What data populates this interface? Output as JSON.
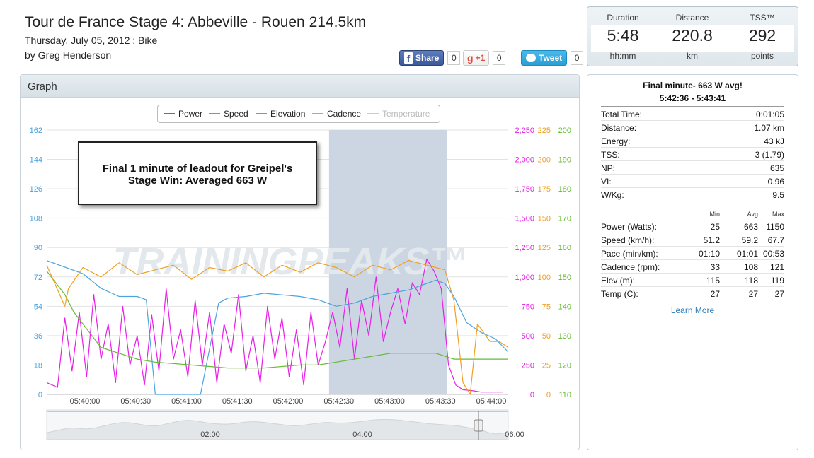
{
  "header": {
    "title": "Tour de France Stage 4: Abbeville - Rouen 214.5km",
    "date": "Thursday, July 05, 2012 : Bike",
    "author": "by Greg Henderson"
  },
  "social": {
    "facebook_label": "Share",
    "facebook_count": "0",
    "gplus_label": "+1",
    "gplus_count": "0",
    "twitter_label": "Tweet",
    "twitter_count": "0"
  },
  "summary": {
    "columns": [
      {
        "label": "Duration",
        "value": "5:48",
        "unit": "hh:mm"
      },
      {
        "label": "Distance",
        "value": "220.8",
        "unit": "km"
      },
      {
        "label": "TSS™",
        "value": "292",
        "unit": "points"
      }
    ]
  },
  "graph": {
    "title": "Graph",
    "watermark": "TRAININGPEAKS™",
    "annotation_line1": "Final 1 minute of leadout for Greipel's",
    "annotation_line2": "Stage Win: Averaged 663 W",
    "legend": [
      {
        "label": "Power",
        "color": "#e81ee8"
      },
      {
        "label": "Speed",
        "color": "#4aa3df"
      },
      {
        "label": "Elevation",
        "color": "#66bb33"
      },
      {
        "label": "Cadence",
        "color": "#f0a022"
      },
      {
        "label": "Temperature",
        "color": "#cccccc"
      }
    ],
    "navigator_ticks": [
      "02:00",
      "04:00",
      "06:00"
    ]
  },
  "chart_data": {
    "type": "line",
    "x_ticks": [
      "05:40:00",
      "05:40:30",
      "05:41:00",
      "05:41:30",
      "05:42:00",
      "05:42:30",
      "05:43:00",
      "05:43:30",
      "05:44:00"
    ],
    "axes": [
      {
        "name": "speed",
        "color": "#4aa3df",
        "ticks": [
          "162",
          "144",
          "126",
          "108",
          "90",
          "72",
          "54",
          "36",
          "18",
          "0"
        ]
      },
      {
        "name": "power",
        "color": "#e81ee8",
        "ticks": [
          "2,250",
          "2,000",
          "1,750",
          "1,500",
          "1,250",
          "1,000",
          "750",
          "500",
          "250",
          "0"
        ]
      },
      {
        "name": "cadence",
        "color": "#f0a022",
        "ticks": [
          "225",
          "200",
          "175",
          "150",
          "125",
          "100",
          "75",
          "50",
          "25",
          "0"
        ]
      },
      {
        "name": "elevation",
        "color": "#66bb33",
        "ticks": [
          "200",
          "190",
          "180",
          "170",
          "160",
          "150",
          "140",
          "130",
          "120",
          "110"
        ]
      }
    ],
    "x_range_seconds": [
      0,
      255
    ],
    "selection_seconds": [
      156,
      221
    ],
    "series": [
      {
        "name": "Power",
        "color": "#e81ee8",
        "axis": "power",
        "x": [
          0,
          6,
          10,
          14,
          18,
          22,
          26,
          30,
          34,
          38,
          42,
          46,
          50,
          54,
          58,
          62,
          66,
          70,
          74,
          78,
          82,
          86,
          90,
          94,
          98,
          102,
          106,
          110,
          114,
          118,
          122,
          126,
          130,
          134,
          138,
          142,
          146,
          150,
          154,
          158,
          162,
          166,
          170,
          174,
          178,
          182,
          186,
          190,
          194,
          198,
          202,
          206,
          210,
          214,
          218,
          222,
          226,
          230,
          236,
          240,
          246,
          252
        ],
        "values": [
          100,
          60,
          650,
          200,
          700,
          150,
          850,
          300,
          600,
          100,
          750,
          250,
          500,
          80,
          680,
          200,
          900,
          300,
          550,
          150,
          800,
          250,
          700,
          100,
          600,
          350,
          850,
          200,
          500,
          100,
          750,
          300,
          650,
          150,
          550,
          80,
          700,
          250,
          450,
          700,
          400,
          900,
          300,
          800,
          500,
          1000,
          450,
          700,
          900,
          600,
          950,
          850,
          1150,
          1050,
          900,
          250,
          80,
          40,
          30,
          20,
          20,
          20
        ]
      },
      {
        "name": "Speed",
        "color": "#4aa3df",
        "axis": "speed",
        "x": [
          0,
          10,
          20,
          30,
          40,
          50,
          55,
          60,
          62,
          75,
          85,
          95,
          100,
          110,
          120,
          130,
          140,
          150,
          155,
          160,
          170,
          180,
          190,
          200,
          210,
          215,
          220,
          225,
          232,
          240,
          248,
          255
        ],
        "values": [
          82,
          78,
          74,
          65,
          60,
          60,
          58,
          0,
          0,
          0,
          0,
          56,
          59,
          60,
          62,
          61,
          60,
          58,
          56,
          54,
          56,
          60,
          62,
          64,
          68,
          70,
          68,
          60,
          44,
          38,
          34,
          26
        ]
      },
      {
        "name": "Elevation",
        "color": "#66bb33",
        "axis": "elevation",
        "x": [
          0,
          5,
          10,
          15,
          20,
          30,
          40,
          50,
          60,
          80,
          100,
          120,
          140,
          150,
          160,
          170,
          180,
          190,
          200,
          210,
          215,
          220,
          225,
          230,
          240,
          255
        ],
        "values": [
          152,
          148,
          144,
          138,
          134,
          126,
          124,
          122,
          121,
          120,
          119,
          119,
          120,
          120,
          121,
          122,
          123,
          124,
          124,
          124,
          124,
          123,
          122,
          122,
          122,
          122
        ]
      },
      {
        "name": "Cadence",
        "color": "#f0a022",
        "axis": "cadence",
        "x": [
          0,
          10,
          12,
          20,
          30,
          40,
          50,
          60,
          70,
          80,
          90,
          100,
          110,
          120,
          130,
          140,
          150,
          160,
          170,
          180,
          190,
          200,
          210,
          220,
          225,
          230,
          234,
          238,
          245,
          250,
          255
        ],
        "values": [
          110,
          75,
          90,
          108,
          100,
          112,
          102,
          106,
          110,
          98,
          108,
          105,
          112,
          100,
          110,
          104,
          112,
          108,
          100,
          110,
          106,
          114,
          110,
          106,
          80,
          10,
          0,
          60,
          45,
          45,
          40
        ]
      }
    ]
  },
  "stats": {
    "title": "Final minute- 663 W avg!",
    "range": "5:42:36 - 5:43:41",
    "summary_rows": [
      {
        "label": "Total Time:",
        "value": "0:01:05"
      },
      {
        "label": "Distance:",
        "value": "1.07 km"
      },
      {
        "label": "Energy:",
        "value": "43 kJ"
      },
      {
        "label": "TSS:",
        "value": "3 (1.79)"
      },
      {
        "label": "NP:",
        "value": "635"
      },
      {
        "label": "VI:",
        "value": "0.96"
      },
      {
        "label": "W/Kg:",
        "value": "9.5"
      }
    ],
    "col_headers": [
      "Min",
      "Avg",
      "Max"
    ],
    "metric_rows": [
      {
        "label": "Power (Watts):",
        "min": "25",
        "avg": "663",
        "max": "1150"
      },
      {
        "label": "Speed (km/h):",
        "min": "51.2",
        "avg": "59.2",
        "max": "67.7"
      },
      {
        "label": "Pace (min/km):",
        "min": "01:10",
        "avg": "01:01",
        "max": "00:53"
      },
      {
        "label": "Cadence (rpm):",
        "min": "33",
        "avg": "108",
        "max": "121"
      },
      {
        "label": "Elev (m):",
        "min": "115",
        "avg": "118",
        "max": "119"
      },
      {
        "label": "Temp (C):",
        "min": "27",
        "avg": "27",
        "max": "27"
      }
    ],
    "learn_more": "Learn More"
  }
}
